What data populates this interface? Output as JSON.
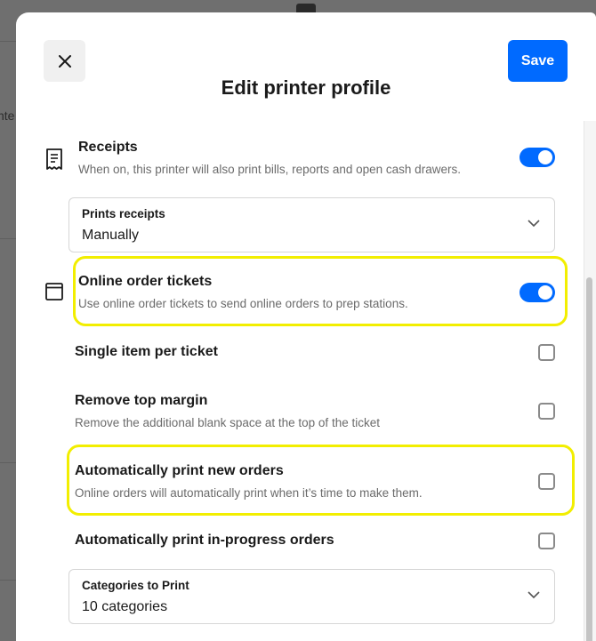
{
  "modal": {
    "title": "Edit printer profile",
    "save_label": "Save"
  },
  "background": {
    "fragment_text": "nte"
  },
  "receipts": {
    "title": "Receipts",
    "description": "When on, this printer will also print bills, reports and open cash drawers.",
    "enabled": true,
    "select": {
      "label": "Prints receipts",
      "value": "Manually"
    }
  },
  "online_order_tickets": {
    "title": "Online order tickets",
    "description": "Use online order tickets to send online orders to prep stations.",
    "enabled": true
  },
  "options": [
    {
      "title": "Single item per ticket",
      "description": "",
      "checked": false
    },
    {
      "title": "Remove top margin",
      "description": "Remove the additional blank space at the top of the ticket",
      "checked": false
    },
    {
      "title": "Automatically print new orders",
      "description": "Online orders will automatically print when it’s time to make them.",
      "checked": false
    },
    {
      "title": "Automatically print in-progress orders",
      "description": "",
      "checked": false
    }
  ],
  "categories": {
    "label": "Categories to Print",
    "value": "10 categories"
  },
  "colors": {
    "accent": "#006aff",
    "highlight": "#f2ee00"
  },
  "icons": {
    "close": "close-icon",
    "receipt": "receipt-icon",
    "ticket": "ticket-window-icon",
    "chevron": "chevron-down-icon"
  }
}
